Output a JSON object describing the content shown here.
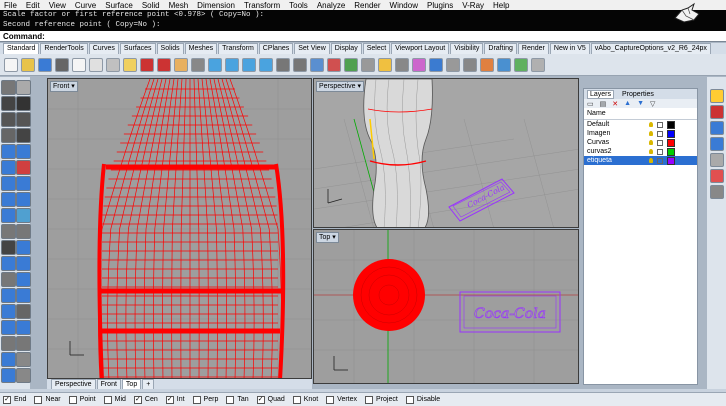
{
  "menu": [
    "File",
    "Edit",
    "View",
    "Curve",
    "Surface",
    "Solid",
    "Mesh",
    "Dimension",
    "Transform",
    "Tools",
    "Analyze",
    "Render",
    "Window",
    "Plugins",
    "V-Ray",
    "Help"
  ],
  "command_history": [
    "Scale factor or first reference point <0.978> ( Copy=No ):",
    "Second reference point ( Copy=No ):"
  ],
  "command_prompt": "Command:",
  "toolbar_tabs": [
    "Standard",
    "RenderTools",
    "Curves",
    "Surfaces",
    "Solids",
    "Meshes",
    "Transform",
    "CPlanes",
    "Set View",
    "Display",
    "Select",
    "Viewport Layout",
    "Visibility",
    "Drafting",
    "Render",
    "New in V5",
    "vAbo_CaptureOptions_v2_R6_24px"
  ],
  "viewports": {
    "front": "Front",
    "perspective": "Perspective",
    "top": "Top"
  },
  "viewport_tabs": [
    "Perspective",
    "Front",
    "Top"
  ],
  "layers_panel": {
    "tabs": [
      "Layers",
      "Properties"
    ],
    "column_header": "Name",
    "layers": [
      {
        "name": "Default",
        "color": "#000000"
      },
      {
        "name": "Imagen",
        "color": "#0000ff"
      },
      {
        "name": "Curvas",
        "color": "#ff0000"
      },
      {
        "name": "curvas2",
        "color": "#00cc00"
      },
      {
        "name": "etiqueta",
        "color": "#9900ff",
        "selected": true
      }
    ]
  },
  "osnaps": [
    {
      "label": "End",
      "checked": true
    },
    {
      "label": "Near",
      "checked": false
    },
    {
      "label": "Point",
      "checked": false
    },
    {
      "label": "Mid",
      "checked": false
    },
    {
      "label": "Cen",
      "checked": true
    },
    {
      "label": "Int",
      "checked": true
    },
    {
      "label": "Perp",
      "checked": false
    },
    {
      "label": "Tan",
      "checked": false
    },
    {
      "label": "Quad",
      "checked": true
    },
    {
      "label": "Knot",
      "checked": false
    },
    {
      "label": "Vertex",
      "checked": false
    },
    {
      "label": "Project",
      "checked": false
    },
    {
      "label": "Disable",
      "checked": false
    }
  ],
  "label_text": "Coca-Cola",
  "accent_colors": {
    "geometry": "#ff0000",
    "label": "#9933ff",
    "selection": "#2b6fd1"
  }
}
